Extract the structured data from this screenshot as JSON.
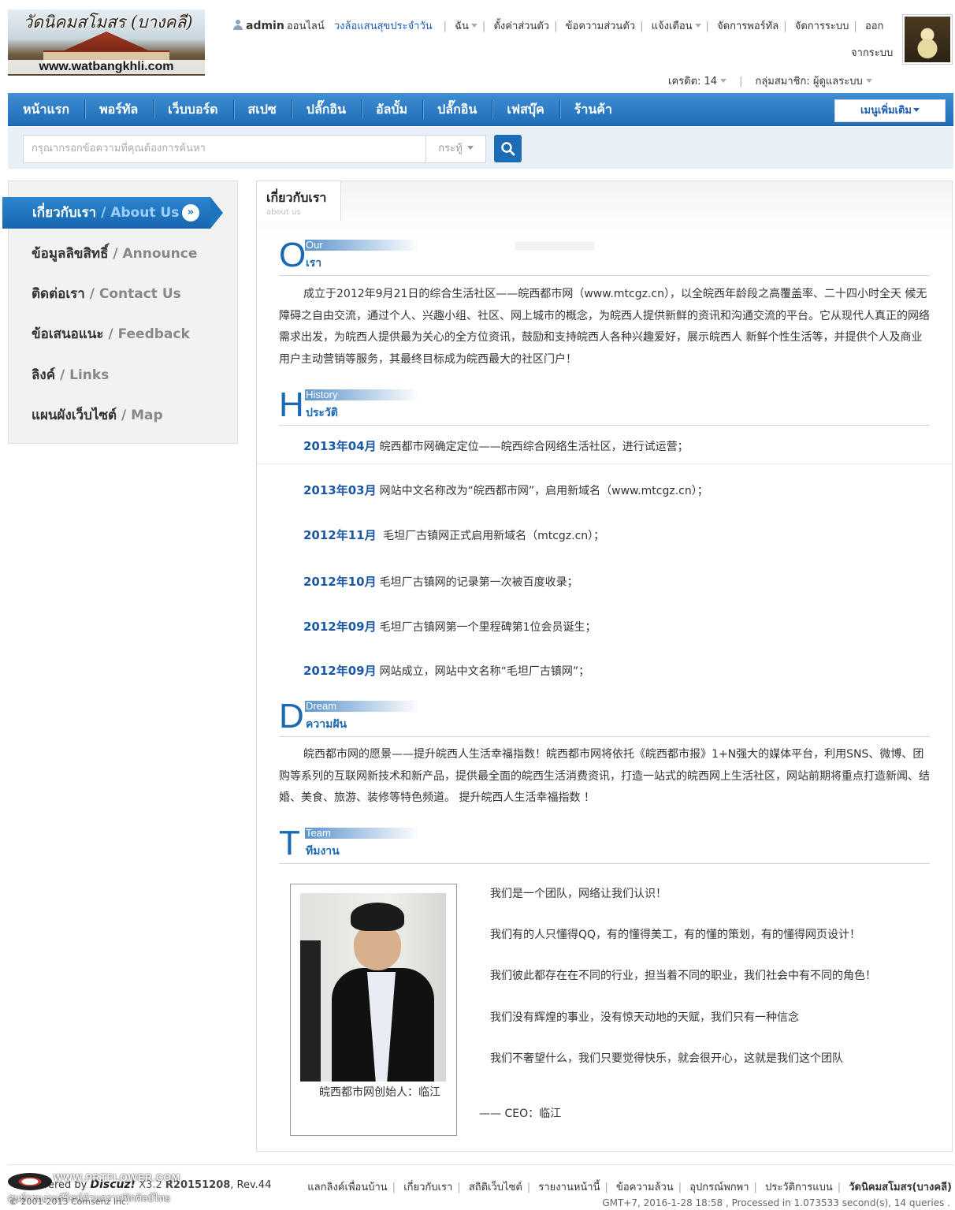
{
  "logo": {
    "text": "วัดนิคมสโมสร (บางคลี)",
    "url": "www.watbangkhli.com"
  },
  "topbar": {
    "username": "admin",
    "status": "ออนไลน์",
    "daily_link": "วงล้อแสนสุขประจำวัน",
    "menu": [
      "ฉัน",
      "ตั้งค่าส่วนตัว",
      "ข้อความส่วนตัว",
      "แจ้งเตือน",
      "จัดการพอร์ทัล",
      "จัดการระบบ"
    ],
    "logout_1": "ออก",
    "logout_2": "จากระบบ",
    "credit": "เครดิต: 14",
    "group": "กลุ่มสมาชิก: ผู้ดูแลระบบ"
  },
  "nav": {
    "items": [
      "หน้าแรก",
      "พอร์ทัล",
      "เว็บบอร์ด",
      "สเปซ",
      "ปลั๊กอิน",
      "อัลบั้ม",
      "ปลั๊กอิน",
      "เฟสบุ๊ค",
      "ร้านค้า"
    ],
    "more": "เมนูเพิ่มเติม"
  },
  "search": {
    "placeholder": "กรุณากรอกข้อความที่คุณต้องการค้นหา",
    "scope": "กระทู้"
  },
  "sidebar": {
    "active_th": "เกี่ยวกับเรา",
    "active_en": " / About Us",
    "items": [
      {
        "th": "ข้อมูลลิขสิทธิ์",
        "en": " / Announce"
      },
      {
        "th": "ติดต่อเรา",
        "en": " / Contact Us"
      },
      {
        "th": "ข้อเสนอแนะ",
        "en": " / Feedback"
      },
      {
        "th": "ลิงค์",
        "en": " / Links"
      },
      {
        "th": "แผนผังเว็บไซต์",
        "en": " / Map"
      }
    ]
  },
  "panel": {
    "tab_th": "เกี่ยวกับเรา",
    "tab_en": "about us"
  },
  "sections": {
    "our": {
      "letter": "O",
      "en": "Our",
      "th": "เรา"
    },
    "history": {
      "letter": "H",
      "en": "History",
      "th": "ประวัติ"
    },
    "dream": {
      "letter": "D",
      "en": "Dream",
      "th": "ความฝัน"
    },
    "team": {
      "letter": "T",
      "en": "Team",
      "th": "ทีมงาน"
    }
  },
  "our_text": "成立于2012年9月21日的综合生活社区——皖西都市网（www.mtcgz.cn），以全皖西年龄段之高覆盖率、二十四小时全天 候无障碍之自由交流，通过个人、兴趣小组、社区、网上城市的概念，为皖西人提供新鲜的资讯和沟通交流的平台。它从现代人真正的网络需求出发，为皖西人提供最为关心的全方位资讯，鼓励和支持皖西人各种兴趣爱好，展示皖西人 新鲜个性生活等，并提供个人及商业用户主动营销等服务，其最终目标成为皖西最大的社区门户！",
  "history": [
    {
      "date": "2013年04月",
      "text": "皖西都市网确定定位——皖西综合网络生活社区，进行试运营；"
    },
    {
      "date": "2013年03月",
      "text": "网站中文名称改为“皖西都市网”，启用新域名（www.mtcgz.cn）；"
    },
    {
      "date": "2012年11月",
      "text": " 毛坦厂古镇网正式启用新域名（mtcgz.cn）；"
    },
    {
      "date": "2012年10月",
      "text": "毛坦厂古镇网的记录第一次被百度收录；"
    },
    {
      "date": "2012年09月",
      "text": "毛坦厂古镇网第一个里程碑第1位会员诞生；"
    },
    {
      "date": "2012年09月",
      "text": "网站成立，网站中文名称“毛坦厂古镇网”；"
    }
  ],
  "dream_text": "皖西都市网的愿景——提升皖西人生活幸福指数！皖西都市网将依托《皖西都市报》1+N强大的媒体平台，利用SNS、微博、团购等系列的互联网新技术和新产品，提供最全面的皖西生活消费资讯，打造一站式的皖西网上生活社区，网站前期将重点打造新闻、结婚、美食、旅游、装修等特色频道。 提升皖西人生活幸福指数 ！",
  "team": {
    "caption": "皖西都市网创始人：临江",
    "lines": [
      "我们是一个团队，网络让我们认识！",
      "我们有的人只懂得QQ，有的懂得美工，有的懂的策划，有的懂得网页设计！",
      "我们彼此都存在在不同的行业，担当着不同的职业，我们社会中有不同的角色！",
      "我们没有辉煌的事业，没有惊天动地的天赋，我们只有一种信念",
      "我们不奢望什么，我们只要觉得快乐，就会很开心，这就是我们这个团队"
    ],
    "ceo": "—— CEO：临江"
  },
  "footer": {
    "watermark": "WWW.PRTFLOWER.COM",
    "powered_prefix": "Powered by ",
    "brand": "Discuz!",
    "version": " X3.2 ",
    "build": "R20151208",
    "rev": ", Rev.44",
    "watermark2": "ศูนย์รวมงานดีไซน์ด้านกราฟฟิกศิลป์ไทย",
    "copyright": "© 2001-2013 Comsenz Inc.",
    "links": [
      "แลกลิงค์เพื่อนบ้าน",
      "เกี่ยวกับเรา",
      "สถิติเว็บไซต์",
      "รายงานหน้านี้",
      "ข้อความล้วน",
      "อุปกรณ์พกพา",
      "ประวัติการแบน"
    ],
    "site": "วัดนิคมสโมสร(บางคลี)",
    "debug": "GMT+7, 2016-1-28 18:58 , Processed in 1.073533 second(s), 14 queries ."
  },
  "colors": {
    "nav_blue": "#1f6cb8",
    "accent_text": "#1a69b3",
    "link_blue": "#1e5fb0"
  }
}
